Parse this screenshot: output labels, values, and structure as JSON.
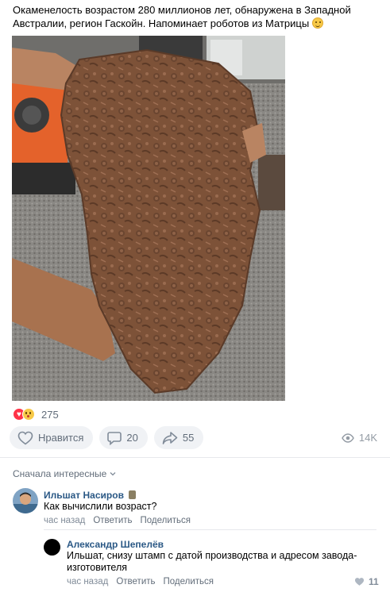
{
  "post": {
    "text": "Окаменелость возрастом 280 миллионов лет, обнаружена в Западной Австралии, регион Гаскойн. Напоминает роботов из Матрицы",
    "emoji": "flushed-face-emoji"
  },
  "photo": {
    "description_icon": "fossil-photo"
  },
  "reactions": {
    "count": "275",
    "icons": [
      "heart-reaction-icon",
      "wow-reaction-icon"
    ]
  },
  "actions": {
    "like_label": "Нравится",
    "comment_count": "20",
    "share_count": "55",
    "views": "14K"
  },
  "comments_header": {
    "sort_label": "Сначала интересные"
  },
  "comments": [
    {
      "author": "Ильшат Насиров",
      "text": "Как вычислили возраст?",
      "time": "час назад",
      "reply": "Ответить",
      "share": "Поделиться"
    },
    {
      "author": "Александр Шепелёв",
      "text": "Ильшат, снизу штамп с датой производства и адресом завода-изготовителя",
      "time": "час назад",
      "reply": "Ответить",
      "share": "Поделиться",
      "likes": "11"
    }
  ],
  "colors": {
    "link": "#2a5885",
    "muted": "#626d7a",
    "button_bg": "#f0f2f5",
    "heart": "#ff3347"
  }
}
